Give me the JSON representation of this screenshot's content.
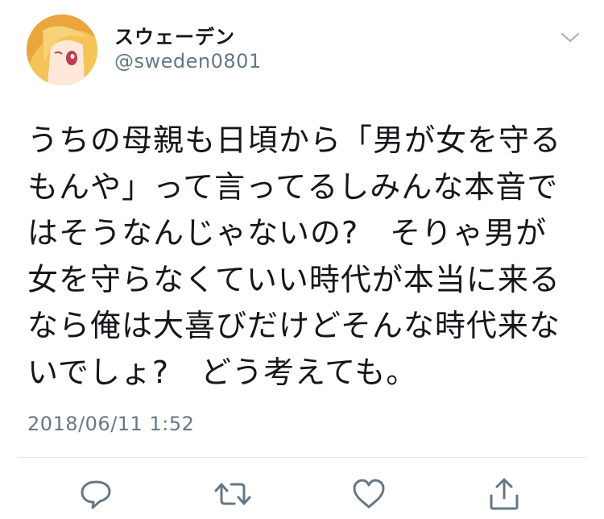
{
  "user": {
    "display_name": "スウェーデン",
    "handle": "@sweden0801",
    "avatar": "avatar-anime-girl"
  },
  "tweet": {
    "text": "うちの母親も日頃から「男が女を守る\nもんや」って言ってるしみんな本音で\nはそうなんじゃないの?　そりゃ男が\n女を守らなくていい時代が本当に来る\nなら俺は大喜びだけどそんな時代来な\nいでしょ?　どう考えても。",
    "timestamp": "2018/06/11 1:52"
  },
  "actions": [
    {
      "icon": "reply-icon"
    },
    {
      "icon": "retweet-icon"
    },
    {
      "icon": "like-icon"
    },
    {
      "icon": "share-icon"
    }
  ],
  "colors": {
    "text": "#14171a",
    "secondary": "#657786",
    "divider": "#e1e8ed",
    "icon": "#657786"
  }
}
